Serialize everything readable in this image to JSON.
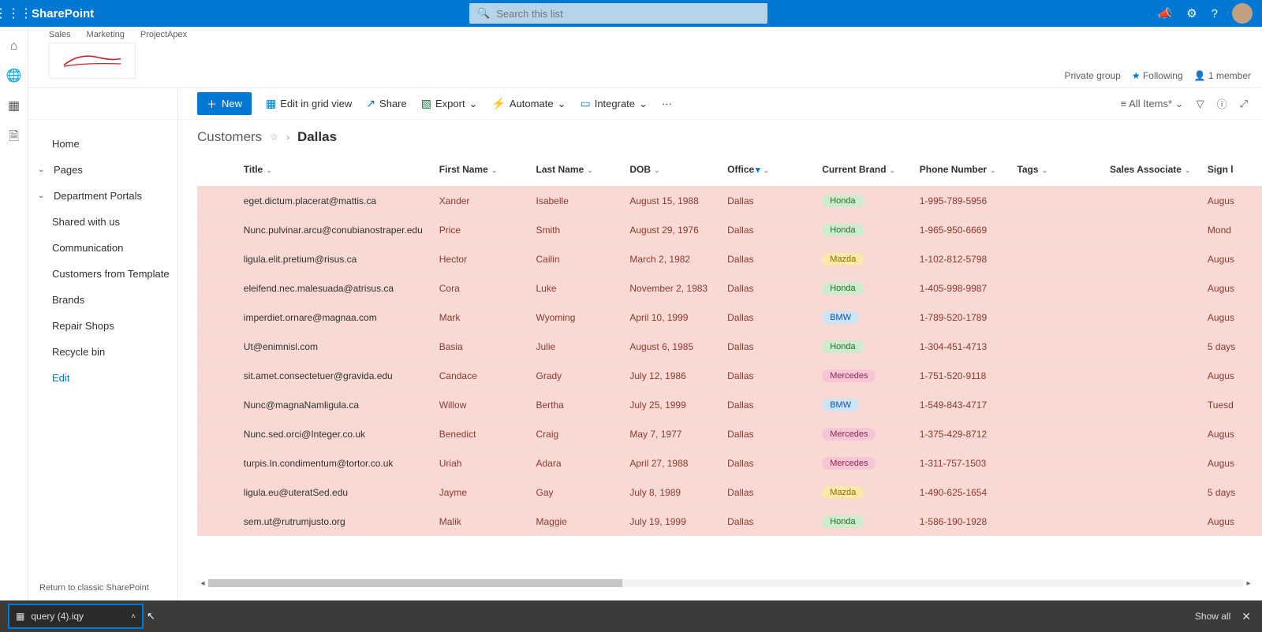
{
  "topbar": {
    "app_name": "SharePoint",
    "search_placeholder": "Search this list"
  },
  "crumbs": [
    "Sales",
    "Marketing",
    "ProjectApex"
  ],
  "header_right": {
    "private": "Private group",
    "following": "Following",
    "members": "1 member"
  },
  "sidenav": {
    "home": "Home",
    "pages": "Pages",
    "dept": "Department Portals",
    "items": [
      "Shared with us",
      "Communication",
      "Customers from Template",
      "Brands",
      "Repair Shops",
      "Recycle bin"
    ],
    "edit": "Edit",
    "return": "Return to classic SharePoint"
  },
  "cmdbar": {
    "new": "New",
    "edit_grid": "Edit in grid view",
    "share": "Share",
    "export": "Export",
    "automate": "Automate",
    "integrate": "Integrate",
    "view": "All Items*"
  },
  "list": {
    "parent": "Customers",
    "current": "Dallas",
    "columns": {
      "title": "Title",
      "first": "First Name",
      "last": "Last Name",
      "dob": "DOB",
      "office": "Office",
      "brand": "Current Brand",
      "phone": "Phone Number",
      "tags": "Tags",
      "assoc": "Sales Associate",
      "sign": "Sign l"
    },
    "rows": [
      {
        "title": "eget.dictum.placerat@mattis.ca",
        "first": "Xander",
        "last": "Isabelle",
        "dob": "August 15, 1988",
        "office": "Dallas",
        "brand": "Honda",
        "phone": "1-995-789-5956",
        "sign": "Augus"
      },
      {
        "title": "Nunc.pulvinar.arcu@conubianostraper.edu",
        "first": "Price",
        "last": "Smith",
        "dob": "August 29, 1976",
        "office": "Dallas",
        "brand": "Honda",
        "phone": "1-965-950-6669",
        "sign": "Mond"
      },
      {
        "title": "ligula.elit.pretium@risus.ca",
        "first": "Hector",
        "last": "Cailin",
        "dob": "March 2, 1982",
        "office": "Dallas",
        "brand": "Mazda",
        "phone": "1-102-812-5798",
        "sign": "Augus"
      },
      {
        "title": "eleifend.nec.malesuada@atrisus.ca",
        "first": "Cora",
        "last": "Luke",
        "dob": "November 2, 1983",
        "office": "Dallas",
        "brand": "Honda",
        "phone": "1-405-998-9987",
        "sign": "Augus"
      },
      {
        "title": "imperdiet.ornare@magnaa.com",
        "first": "Mark",
        "last": "Wyoming",
        "dob": "April 10, 1999",
        "office": "Dallas",
        "brand": "BMW",
        "phone": "1-789-520-1789",
        "sign": "Augus"
      },
      {
        "title": "Ut@enimnisl.com",
        "first": "Basia",
        "last": "Julie",
        "dob": "August 6, 1985",
        "office": "Dallas",
        "brand": "Honda",
        "phone": "1-304-451-4713",
        "sign": "5 days"
      },
      {
        "title": "sit.amet.consectetuer@gravida.edu",
        "first": "Candace",
        "last": "Grady",
        "dob": "July 12, 1986",
        "office": "Dallas",
        "brand": "Mercedes",
        "phone": "1-751-520-9118",
        "sign": "Augus"
      },
      {
        "title": "Nunc@magnaNamligula.ca",
        "first": "Willow",
        "last": "Bertha",
        "dob": "July 25, 1999",
        "office": "Dallas",
        "brand": "BMW",
        "phone": "1-549-843-4717",
        "sign": "Tuesd"
      },
      {
        "title": "Nunc.sed.orci@Integer.co.uk",
        "first": "Benedict",
        "last": "Craig",
        "dob": "May 7, 1977",
        "office": "Dallas",
        "brand": "Mercedes",
        "phone": "1-375-429-8712",
        "sign": "Augus"
      },
      {
        "title": "turpis.In.condimentum@tortor.co.uk",
        "first": "Uriah",
        "last": "Adara",
        "dob": "April 27, 1988",
        "office": "Dallas",
        "brand": "Mercedes",
        "phone": "1-311-757-1503",
        "sign": "Augus"
      },
      {
        "title": "ligula.eu@uteratSed.edu",
        "first": "Jayme",
        "last": "Gay",
        "dob": "July 8, 1989",
        "office": "Dallas",
        "brand": "Mazda",
        "phone": "1-490-625-1654",
        "sign": "5 days"
      },
      {
        "title": "sem.ut@rutrumjusto.org",
        "first": "Malik",
        "last": "Maggie",
        "dob": "July 19, 1999",
        "office": "Dallas",
        "brand": "Honda",
        "phone": "1-586-190-1928",
        "sign": "Augus"
      }
    ]
  },
  "download": {
    "filename": "query (4).iqy",
    "showall": "Show all"
  }
}
